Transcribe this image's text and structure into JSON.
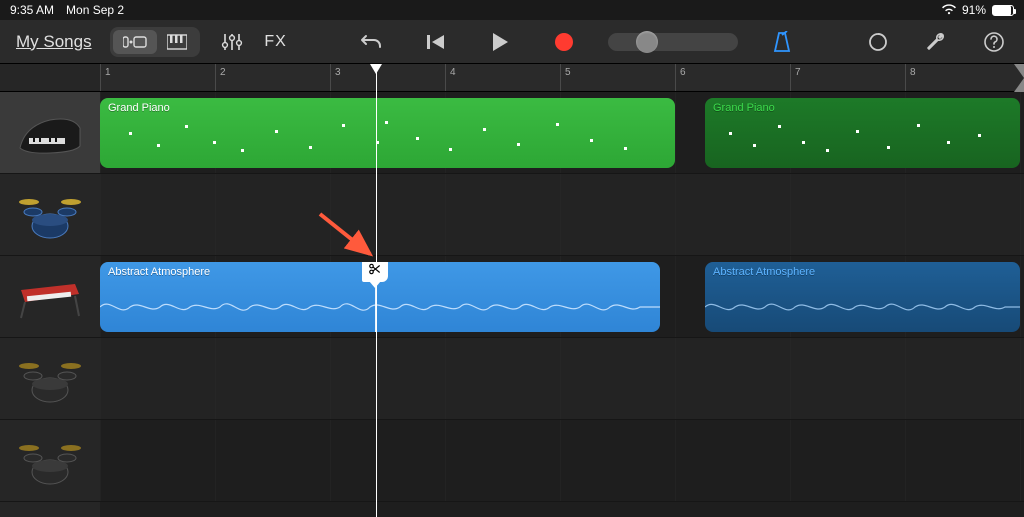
{
  "status": {
    "time": "9:35 AM",
    "date": "Mon Sep 2",
    "battery": "91%"
  },
  "toolbar": {
    "back_label": "My Songs",
    "fx_label": "FX"
  },
  "ruler": {
    "bars": [
      "1",
      "2",
      "3",
      "4",
      "5",
      "6",
      "7",
      "8"
    ]
  },
  "tracks": [
    {
      "name": "Grand Piano",
      "instrument": "piano"
    },
    {
      "name": "Drummer",
      "instrument": "drums-blue"
    },
    {
      "name": "Abstract Atmosphere",
      "instrument": "keyboard-red"
    },
    {
      "name": "Drummer",
      "instrument": "drums-dark"
    },
    {
      "name": "Drummer",
      "instrument": "drums-dark"
    }
  ],
  "regions": {
    "piano1": "Grand Piano",
    "piano2": "Grand Piano",
    "atmos1": "Abstract Atmosphere",
    "atmos2": "Abstract Atmosphere"
  },
  "icons": {
    "scissors": "scissors-icon"
  }
}
